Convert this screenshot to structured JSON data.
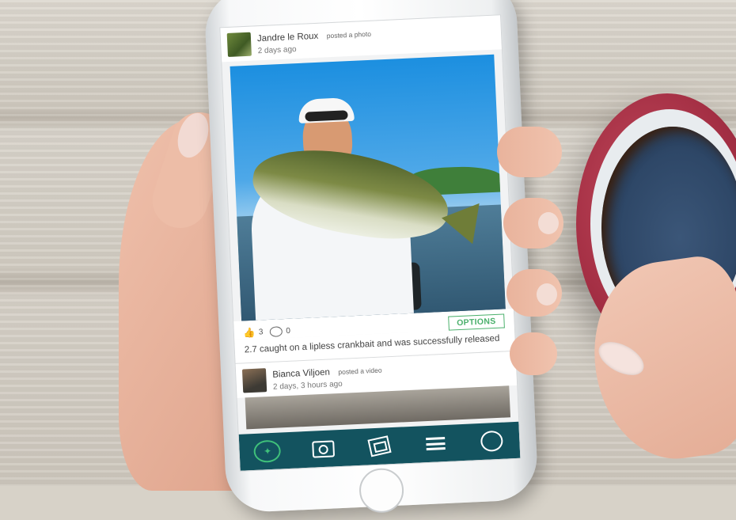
{
  "feed": {
    "post1": {
      "author": "Jandre le Roux",
      "action": "posted a photo",
      "time": "2 days ago",
      "likes": "3",
      "comments": "0",
      "options_label": "OPTIONS",
      "caption": "2.7 caught on a lipless crankbait and was successfully released"
    },
    "post2": {
      "author": "Bianca Viljoen",
      "action": "posted a video",
      "time": "2 days, 3 hours ago"
    }
  },
  "nav": {
    "items": [
      {
        "icon": "fish-speech-icon",
        "active": true
      },
      {
        "icon": "camera-icon"
      },
      {
        "icon": "gallery-icon"
      },
      {
        "icon": "menu-icon"
      },
      {
        "icon": "logbook-icon"
      }
    ],
    "active_color": "#3fc07a",
    "bar_color": "#13535f"
  },
  "colors": {
    "accent": "#4bb06c"
  }
}
